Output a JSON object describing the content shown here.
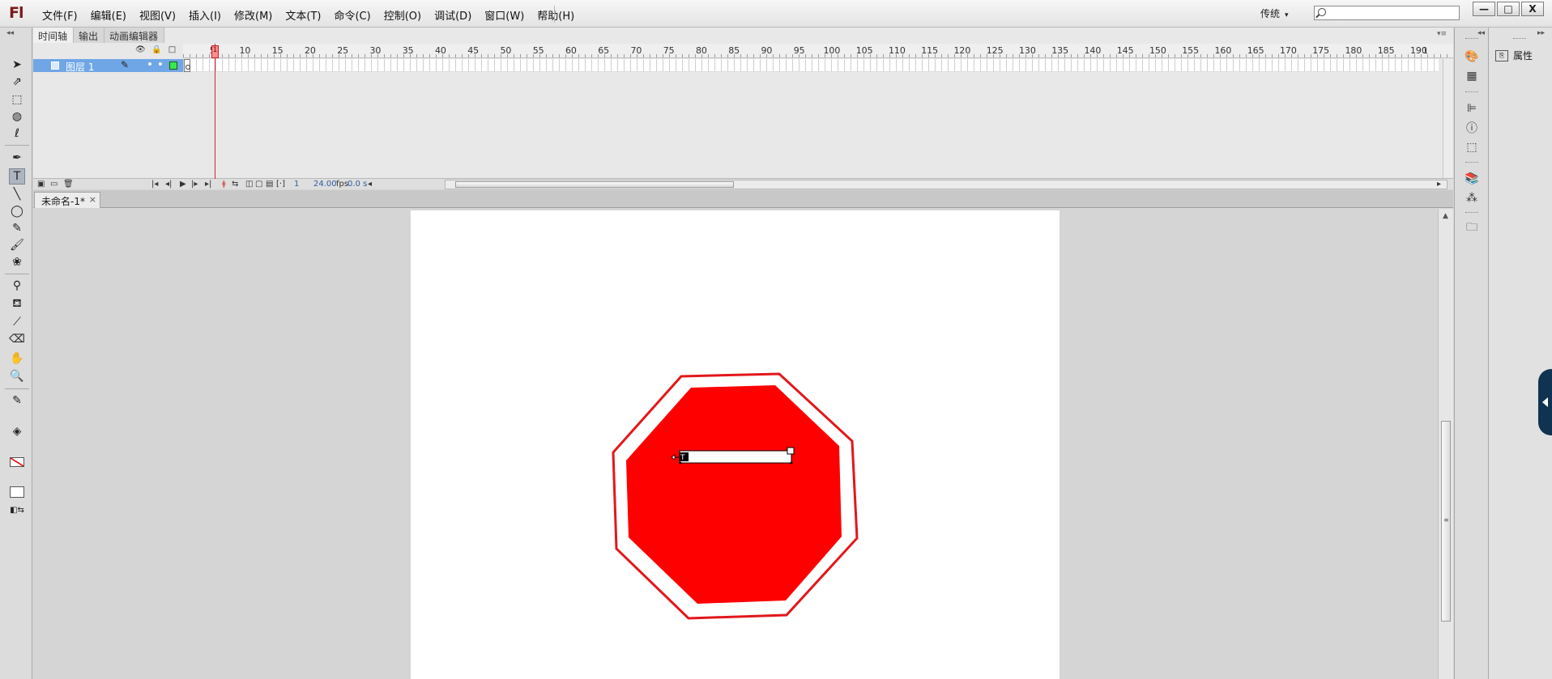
{
  "app": {
    "logo": "Fl"
  },
  "menu": {
    "items": [
      "文件(F)",
      "编辑(E)",
      "视图(V)",
      "插入(I)",
      "修改(M)",
      "文本(T)",
      "命令(C)",
      "控制(O)",
      "调试(D)",
      "窗口(W)",
      "帮助(H)"
    ]
  },
  "workspace": {
    "label": "传统"
  },
  "search": {
    "placeholder": ""
  },
  "window_controls": {
    "minimize": "—",
    "maximize": "□",
    "close": "X"
  },
  "timeline": {
    "tabs": [
      "时间轴",
      "输出",
      "动画编辑器"
    ],
    "ruler_labels": [
      "1",
      "5",
      "10",
      "15",
      "20",
      "25",
      "30",
      "35",
      "40",
      "45",
      "50",
      "55",
      "60",
      "65",
      "70",
      "75",
      "80",
      "85",
      "90",
      "95",
      "100",
      "105",
      "110",
      "115",
      "120",
      "125",
      "130",
      "135",
      "140",
      "145",
      "150",
      "155",
      "160",
      "165",
      "170",
      "175",
      "180",
      "185",
      "190",
      "1"
    ],
    "layer": {
      "name": "图层 1"
    },
    "current_frame": "1",
    "fps": "24.00",
    "fps_unit": "fps",
    "time": "0.0 s"
  },
  "document": {
    "tab_title": "未命名-1*",
    "close": "×"
  },
  "properties": {
    "label": "属性"
  },
  "colors": {
    "sign_red": "#ff0000",
    "sign_border": "#e2171b",
    "layer_highlight": "#6fa6e6"
  },
  "icons": {
    "tools": [
      "selection-arrow-icon",
      "subselection-arrow-icon",
      "free-transform-icon",
      "3d-rotation-icon",
      "lasso-icon",
      "pen-icon",
      "text-tool-icon",
      "line-tool-icon",
      "oval-tool-icon",
      "pencil-tool-icon",
      "brush-tool-icon",
      "deco-tool-icon",
      "bone-tool-icon",
      "paint-bucket-icon",
      "eyedropper-icon",
      "eraser-icon",
      "hand-tool-icon",
      "zoom-tool-icon"
    ]
  }
}
